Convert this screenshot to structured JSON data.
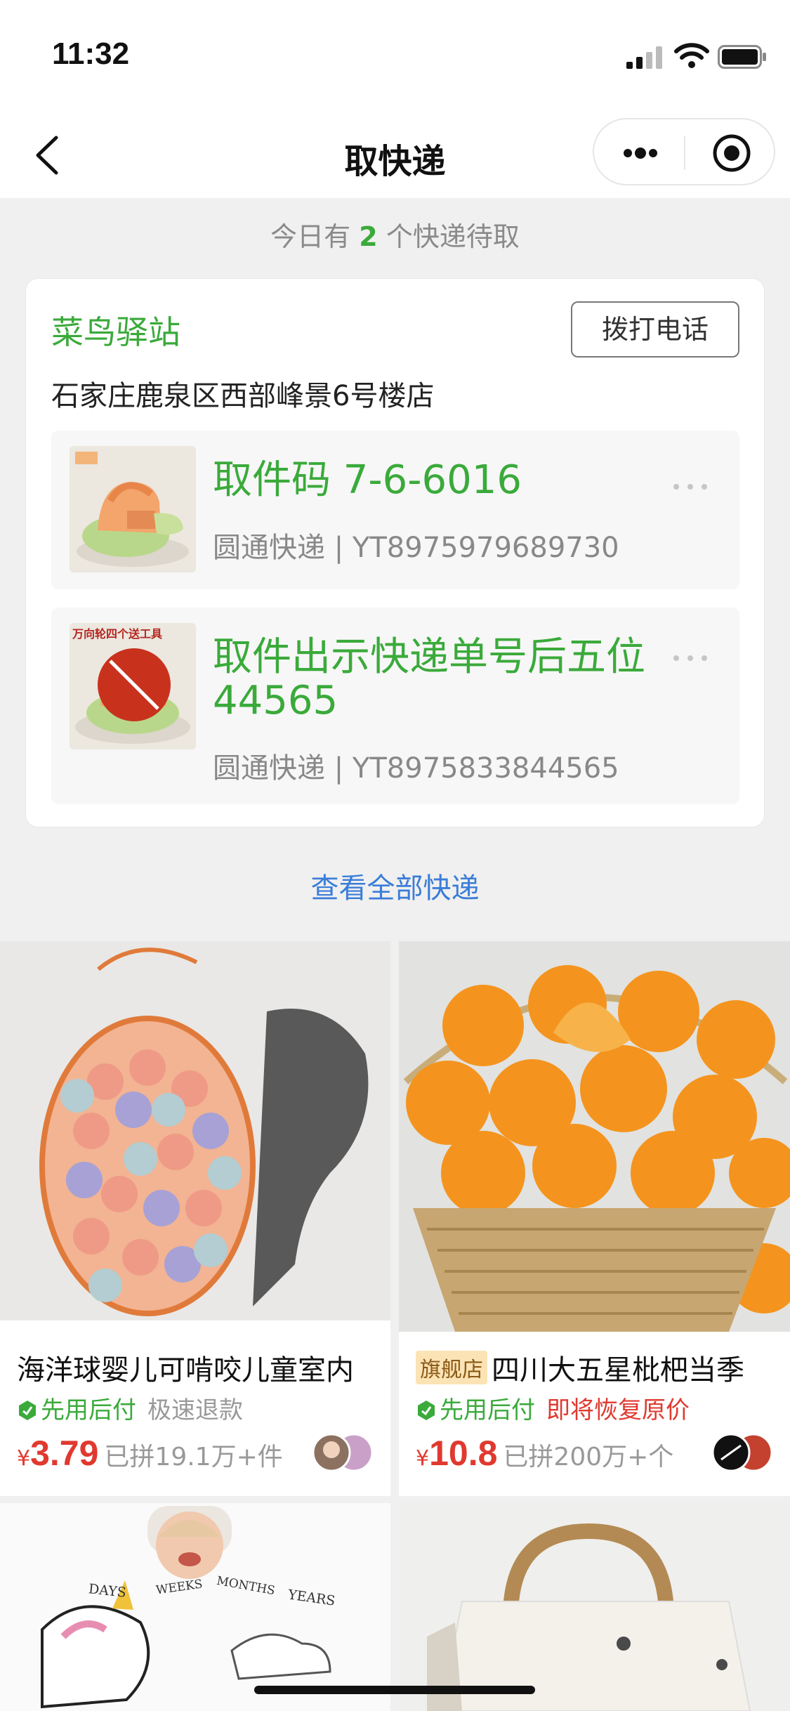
{
  "status_bar": {
    "time": "11:32"
  },
  "navbar": {
    "title": "取快递"
  },
  "notice": {
    "prefix": "今日有",
    "count": "2",
    "suffix": "个快递待取"
  },
  "station": {
    "name": "菜鸟驿站",
    "call_label": "拨打电话",
    "address": "石家庄鹿泉区西部峰景6号楼店",
    "packages": [
      {
        "pickup": "取件码 7-6-6016",
        "carrier": "圆通快递",
        "tracking": "YT8975979689730"
      },
      {
        "pickup": "取件出示快递单号后五位44565",
        "carrier": "圆通快递",
        "tracking": "YT8975833844565",
        "thumb_text": "万向轮四个送工具"
      }
    ]
  },
  "view_all": "查看全部快递",
  "products": [
    {
      "title": "海洋球婴儿可啃咬儿童室内",
      "flagship": "",
      "tag1": "先用后付",
      "tag2": "极速退款",
      "tag2_style": "grey",
      "yen": "¥",
      "price": "3.79",
      "sold": "已拼19.1万+件"
    },
    {
      "title": "四川大五星枇杷当季",
      "flagship": "旗舰店",
      "tag1": "先用后付",
      "tag2": "即将恢复原价",
      "tag2_style": "red",
      "yen": "¥",
      "price": "10.8",
      "sold": "已拼200万+个"
    }
  ],
  "blanket_words": [
    "DAYS",
    "WEEKS",
    "MONTHS",
    "YEARS"
  ],
  "colors": {
    "green": "#3aaa3a",
    "red": "#e0392f",
    "link": "#3b7dd8"
  }
}
